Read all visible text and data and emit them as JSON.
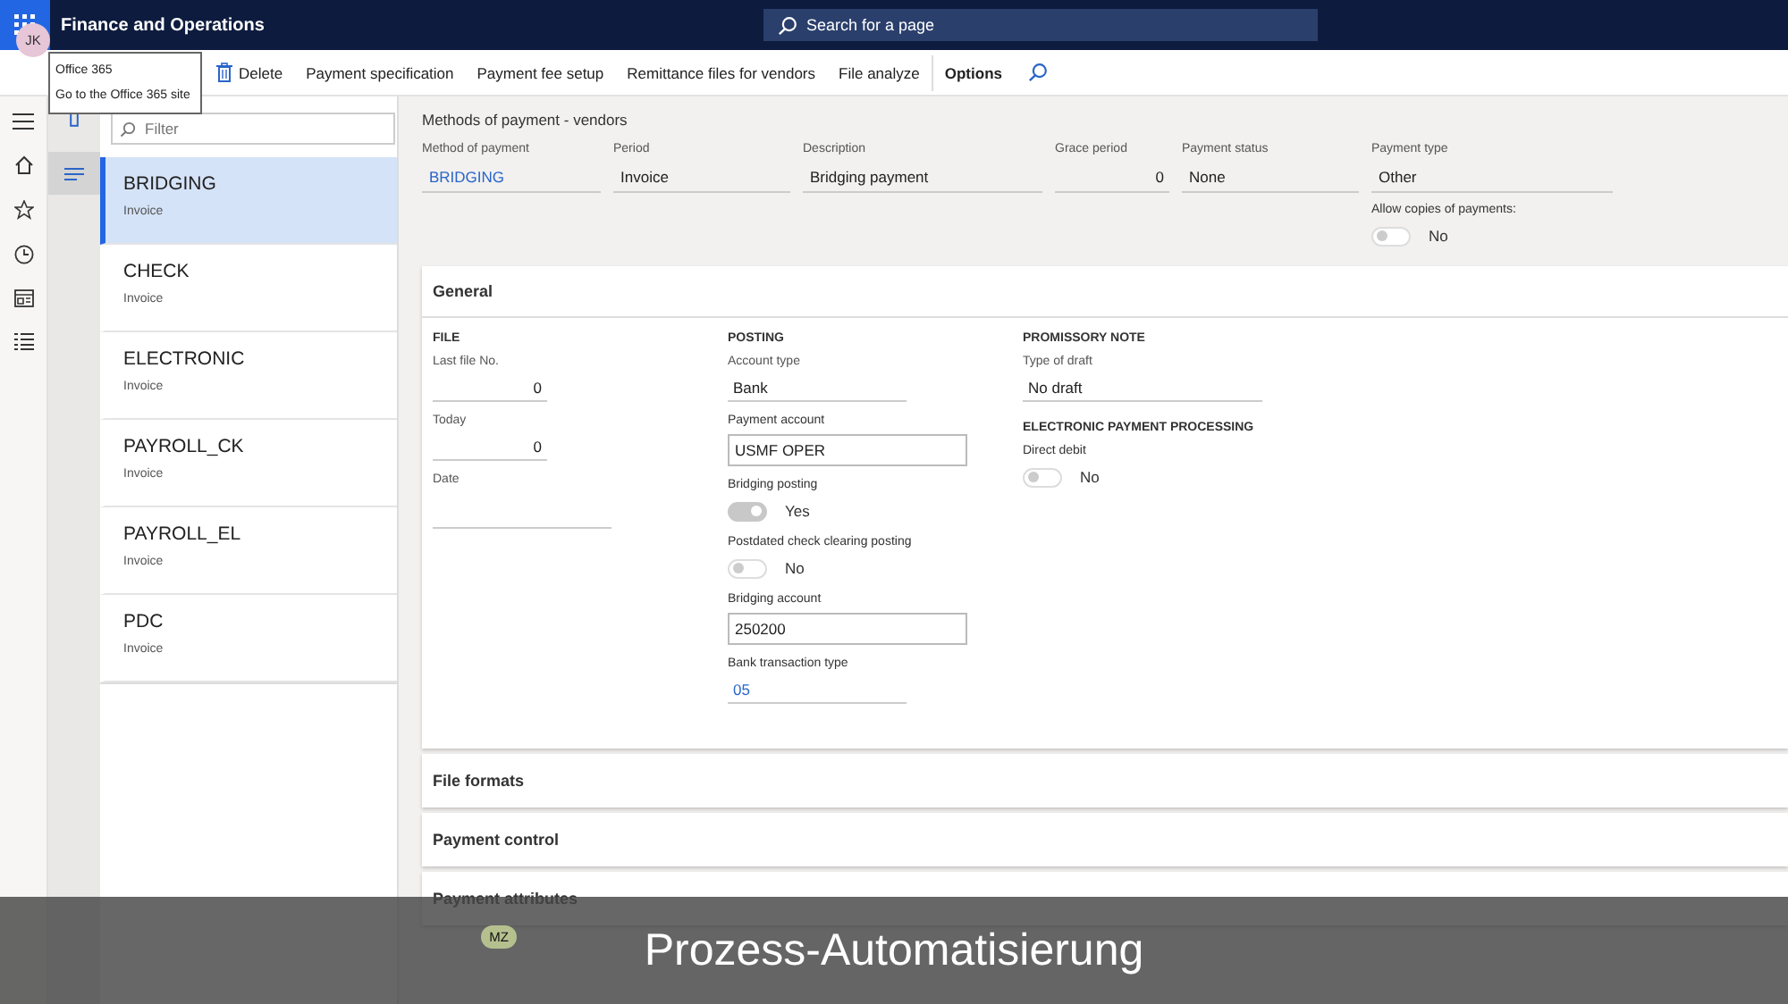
{
  "header": {
    "app_title": "Finance and Operations",
    "search_placeholder": "Search for a page",
    "avatar_initials": "JK"
  },
  "tooltip": {
    "title": "Office 365",
    "text": "Go to the Office 365 site"
  },
  "toolbar": [
    {
      "kind": "delete",
      "label": "Delete"
    },
    {
      "kind": "action",
      "label": "Payment specification"
    },
    {
      "kind": "action",
      "label": "Payment fee setup"
    },
    {
      "kind": "action",
      "label": "Remittance files for vendors"
    },
    {
      "kind": "action",
      "label": "File analyze"
    },
    {
      "kind": "tab",
      "label": "Options"
    },
    {
      "kind": "search"
    }
  ],
  "list": {
    "filter_placeholder": "Filter",
    "items": [
      {
        "name": "BRIDGING",
        "period": "Invoice",
        "selected": true
      },
      {
        "name": "CHECK",
        "period": "Invoice",
        "selected": false
      },
      {
        "name": "ELECTRONIC",
        "period": "Invoice",
        "selected": false
      },
      {
        "name": "PAYROLL_CK",
        "period": "Invoice",
        "selected": false
      },
      {
        "name": "PAYROLL_EL",
        "period": "Invoice",
        "selected": false
      },
      {
        "name": "PDC",
        "period": "Invoice",
        "selected": false
      }
    ]
  },
  "details": {
    "title": "Methods of payment - vendors",
    "fields": [
      {
        "label": "Method of payment",
        "value": "BRIDGING",
        "kind": "link"
      },
      {
        "label": "Period",
        "value": "Invoice",
        "kind": "text"
      },
      {
        "label": "Description",
        "value": "Bridging payment",
        "kind": "text"
      },
      {
        "label": "Grace period",
        "value": "0",
        "kind": "number"
      },
      {
        "label": "Payment status",
        "value": "None",
        "kind": "text"
      },
      {
        "label": "Payment type",
        "value": "Other",
        "kind": "text"
      }
    ],
    "toggle": {
      "label": "Allow copies of payments:",
      "on": false,
      "value": "No"
    }
  },
  "general": {
    "title": "General",
    "groups": [
      {
        "title": "FILE",
        "fields": [
          {
            "label": "Last file No.",
            "value": "0",
            "kind": "number"
          },
          {
            "label": "Today",
            "value": "0",
            "kind": "number"
          },
          {
            "label": "Date",
            "kind": "date"
          }
        ]
      },
      {
        "title": "POSTING",
        "fields": [
          {
            "label": "Account type",
            "value": "Bank",
            "kind": "text"
          },
          {
            "label": "Payment account",
            "value": "USMF OPER",
            "kind": "boxed"
          },
          {
            "label": "Bridging posting",
            "value": "Yes",
            "kind": "toggle",
            "on": true
          },
          {
            "label": "Postdated check clearing posting",
            "value": "No",
            "kind": "toggle",
            "on": false
          },
          {
            "label": "Bridging account",
            "value": "250200",
            "kind": "boxed"
          },
          {
            "label": "Bank transaction type",
            "value": "05",
            "kind": "link"
          }
        ]
      },
      {
        "title": "PROMISSORY NOTE",
        "fields": [
          {
            "label": "Type of draft",
            "value": "No draft",
            "kind": "wide"
          },
          {
            "kind": "heading",
            "label": "ELECTRONIC PAYMENT PROCESSING"
          },
          {
            "label": "Direct debit",
            "value": "No",
            "kind": "toggle",
            "on": false
          }
        ]
      }
    ]
  },
  "sections": [
    {
      "title": "File formats"
    },
    {
      "title": "Payment control"
    },
    {
      "title": "Payment attributes"
    }
  ],
  "cursor_avatar": "MZ",
  "caption": "Prozess-Automatisierung"
}
